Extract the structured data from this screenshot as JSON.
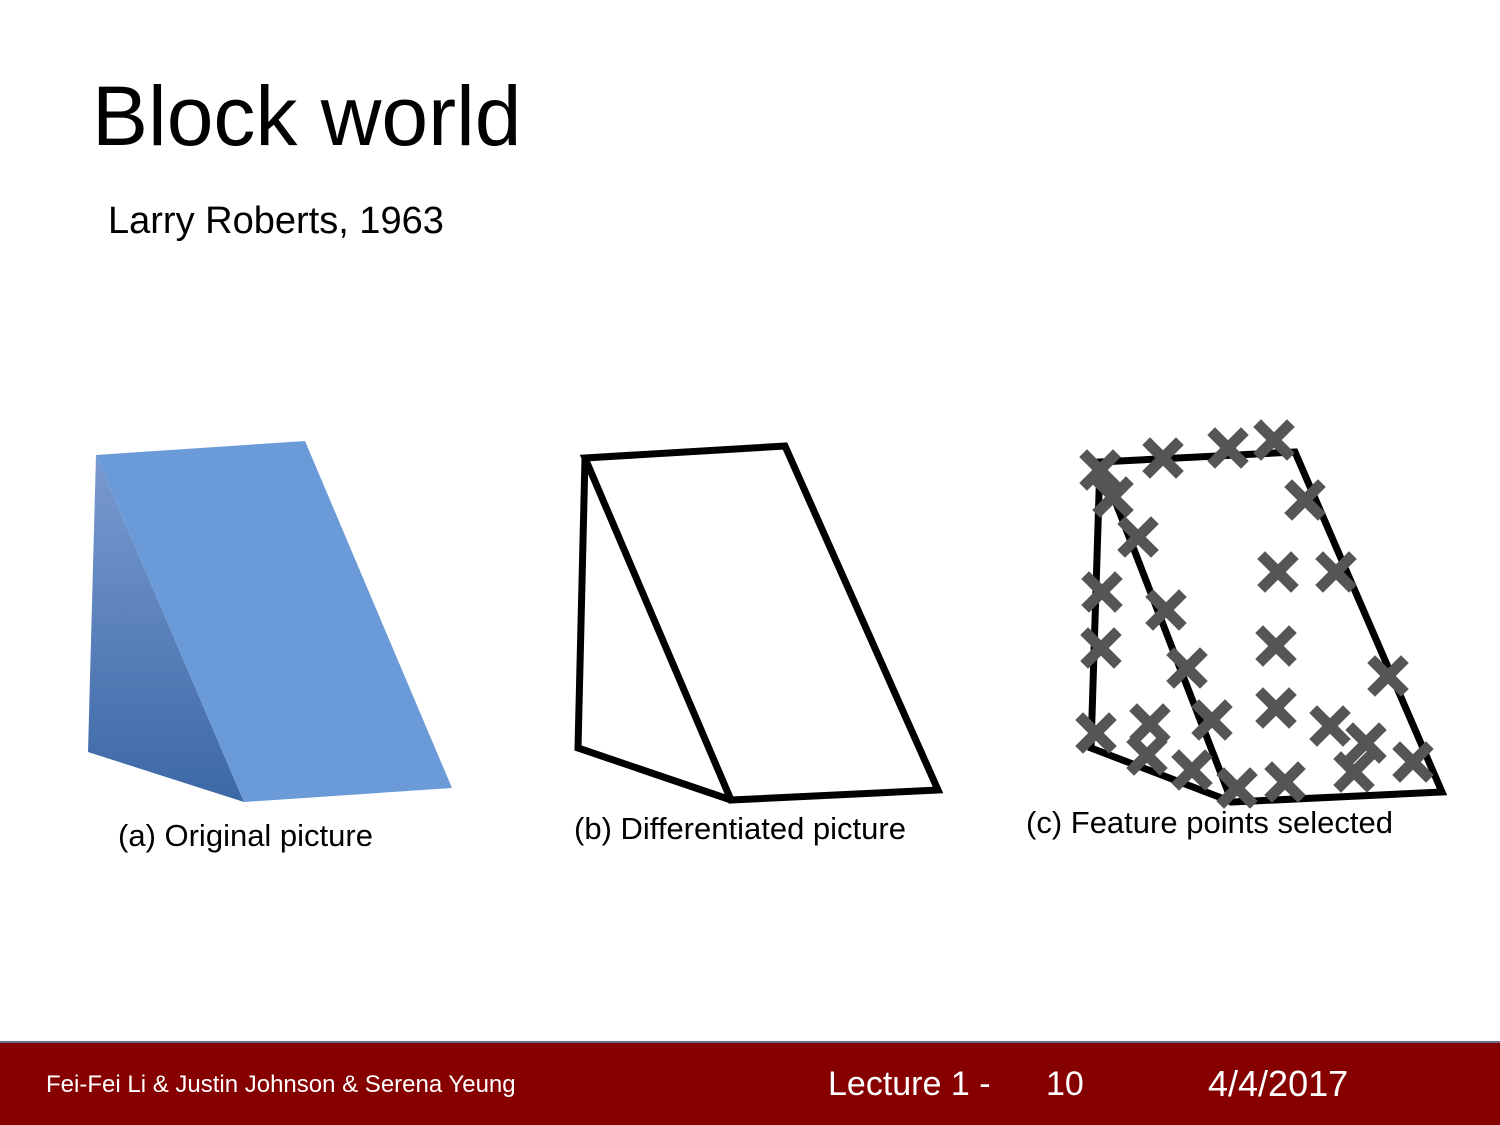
{
  "slide": {
    "title": "Block world",
    "subtitle": "Larry Roberts, 1963"
  },
  "figures": {
    "a": {
      "caption": "(a) Original picture",
      "fill_color": "#6a9bd8",
      "shade_color": "#3b6aa8"
    },
    "b": {
      "caption": "(b) Differentiated picture"
    },
    "c": {
      "caption": "(c) Feature points selected",
      "marker_color": "#555555",
      "marker_icon": "x-mark-icon"
    }
  },
  "footer": {
    "authors": "Fei-Fei Li & Justin Johnson & Serena Yeung",
    "lecture": "Lecture 1 -",
    "page": "10",
    "date": "4/4/2017",
    "background": "#870000"
  }
}
